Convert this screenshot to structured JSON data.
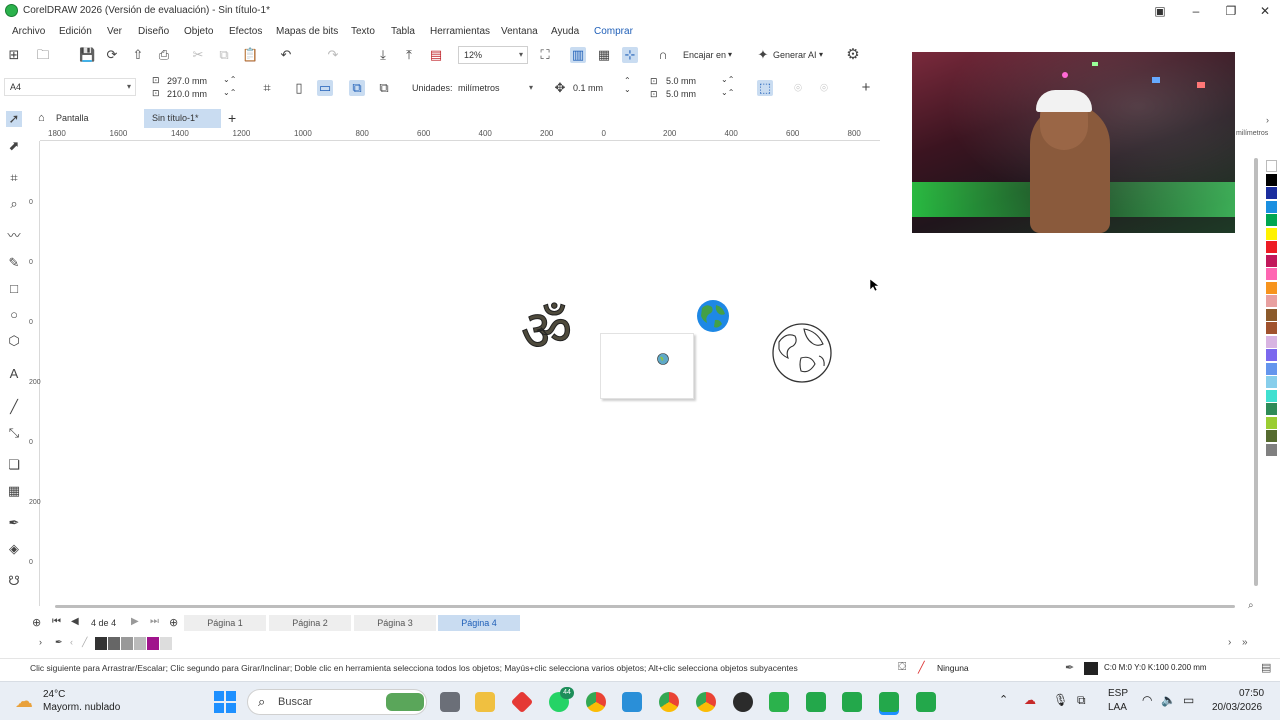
{
  "window": {
    "title": "CorelDRAW 2026 (Versión de evaluación) - Sin título-1*"
  },
  "menu": [
    "Archivo",
    "Edición",
    "Ver",
    "Diseño",
    "Objeto",
    "Efectos",
    "Mapas de bits",
    "Texto",
    "Tabla",
    "Herramientas",
    "Ventana",
    "Ayuda",
    "Comprar"
  ],
  "toolbar": {
    "zoom": "12%",
    "snap": "Encajar en",
    "generate": "Generar AI"
  },
  "propbar": {
    "page_size": "A4",
    "width": "297.0 mm",
    "height": "210.0 mm",
    "units_label": "Unidades:",
    "units_value": "milímetros",
    "nudge": "0.1 mm",
    "dup_x": "5.0 mm",
    "dup_y": "5.0 mm"
  },
  "tabs": {
    "home": "Pantalla de inicio",
    "doc": "Sin título-1*"
  },
  "ruler_h": [
    "1800",
    "1600",
    "1400",
    "1200",
    "1000",
    "800",
    "600",
    "400",
    "200",
    "0",
    "200",
    "400",
    "600",
    "800"
  ],
  "ruler_h_units": "milímetros",
  "ruler_v": [
    "0",
    "0",
    "0",
    "200",
    "0",
    "200",
    "0",
    "00"
  ],
  "pages": {
    "current": "4",
    "of": "de",
    "total": "4",
    "tabs": [
      "Página 1",
      "Página 2",
      "Página 3",
      "Página 4"
    ]
  },
  "status": {
    "hint": "Clic siguiente para Arrastrar/Escalar; Clic segundo para Girar/Inclinar; Doble clic en herramienta selecciona todos los objetos; Mayús+clic selecciona varios objetos; Alt+clic selecciona objetos subyacentes",
    "fill": "Ninguna",
    "outline": "C:0 M:0 Y:0 K:100  0.200 mm"
  },
  "canvas": {
    "om_symbol": "ॐ"
  },
  "taskbar": {
    "temp": "24°C",
    "weather": "Mayorm. nublado",
    "search": "Buscar",
    "lang1": "ESP",
    "lang2": "LAA",
    "time": "07:50",
    "date": "20/03/2026",
    "badge_whatsapp": "44"
  },
  "colors": {
    "accent": "#1f5fb8",
    "selected_bg": "#c9dcf1",
    "palette": [
      "#ffffff",
      "#000000",
      "#1b2e9e",
      "#1a8fe0",
      "#00a651",
      "#fff200",
      "#ed1c24",
      "#c2185b",
      "#ff66b2",
      "#f7941d",
      "#e8a0a0",
      "#8b5a2b",
      "#a0522d",
      "#d8b4e2",
      "#7b68ee",
      "#6495ed",
      "#87ceeb",
      "#40e0d0",
      "#2e8b57",
      "#9acd32",
      "#556b2f",
      "#808080"
    ],
    "doc_palette": [
      "#333333",
      "#666666",
      "#999999",
      "#bbbbbb",
      "#a0148c",
      "#dddddd"
    ]
  }
}
